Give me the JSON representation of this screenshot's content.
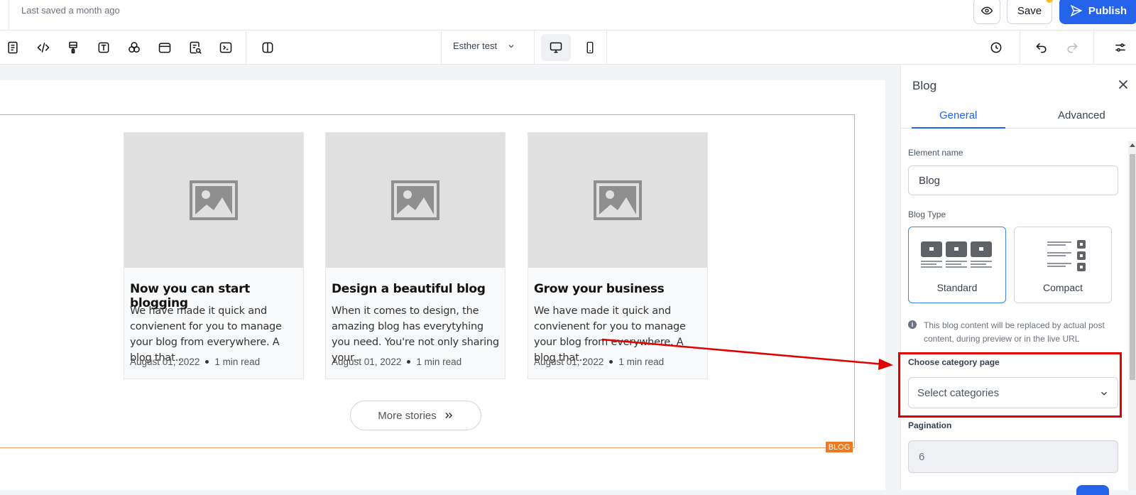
{
  "topbar": {
    "last_saved": "Last saved a month ago",
    "save_label": "Save",
    "publish_label": "Publish"
  },
  "toolbar": {
    "page_name": "Esther test"
  },
  "blog": {
    "posts": [
      {
        "title": "Now you can start blogging",
        "excerpt": "We have made it quick and convienent for you to manage your blog from everywhere. A blog that..",
        "date": "August 01, 2022",
        "read_time": "1 min read"
      },
      {
        "title": "Design a beautiful blog",
        "excerpt": "When it comes to design, the amazing blog has everytyhing you need. You're not only sharing your..",
        "date": "August 01, 2022",
        "read_time": "1 min read"
      },
      {
        "title": "Grow your business",
        "excerpt": "We have made it quick and convienent for you to manage your blog from everywhere. A blog that..",
        "date": "August 01, 2022",
        "read_time": "1 min read"
      }
    ],
    "more_label": "More stories",
    "tag": "BLOG"
  },
  "panel": {
    "title": "Blog",
    "tabs": [
      "General",
      "Advanced"
    ],
    "element_name_label": "Element name",
    "element_name_value": "Blog",
    "blog_type_label": "Blog Type",
    "blog_types": [
      "Standard",
      "Compact"
    ],
    "selected_type": "Standard",
    "info_text": "This blog content will be replaced by actual post content, during preview or in the live URL",
    "category_label": "Choose category page",
    "category_placeholder": "Select categories",
    "pagination_label": "Pagination",
    "pagination_value": "6"
  },
  "colors": {
    "accent": "#2563eb",
    "blog_outline": "#f5a26a",
    "blog_tag": "#f07a21",
    "annotation": "#e00000"
  }
}
